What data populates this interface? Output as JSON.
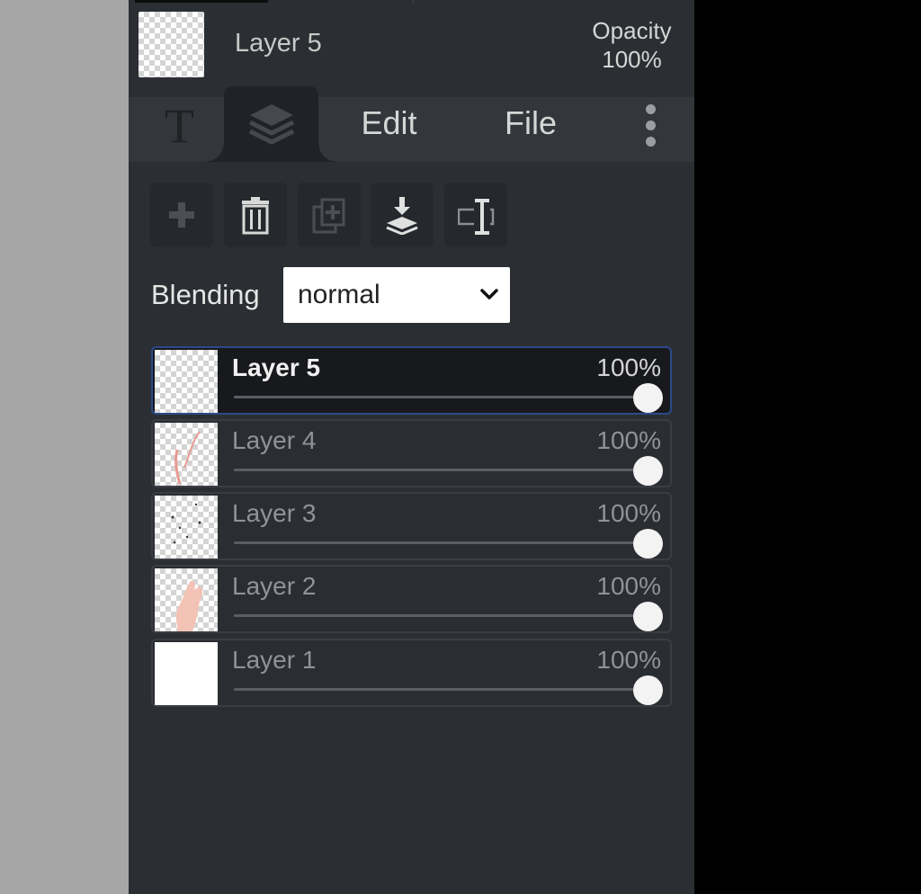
{
  "header": {
    "layer_name": "Layer 5",
    "opacity_label": "Opacity",
    "opacity_value": "100%"
  },
  "tabs": {
    "text_icon_glyph": "T",
    "layers_icon": "layers-stack-icon",
    "edit_label": "Edit",
    "file_label": "File",
    "more_icon": "kebab-menu-icon"
  },
  "toolbar": {
    "buttons": [
      {
        "icon": "add-layer-icon",
        "enabled": false
      },
      {
        "icon": "trash-icon",
        "enabled": true
      },
      {
        "icon": "duplicate-icon",
        "enabled": false
      },
      {
        "icon": "merge-down-icon",
        "enabled": true
      },
      {
        "icon": "rename-icon",
        "enabled": true
      }
    ]
  },
  "blending": {
    "label": "Blending",
    "selected": "normal"
  },
  "layers": [
    {
      "name": "Layer 5",
      "opacity": "100%",
      "opacity_fraction": 1.0,
      "selected": true,
      "thumb": "transparent"
    },
    {
      "name": "Layer 4",
      "opacity": "100%",
      "opacity_fraction": 1.0,
      "selected": false,
      "thumb": "pink-strokes"
    },
    {
      "name": "Layer 3",
      "opacity": "100%",
      "opacity_fraction": 1.0,
      "selected": false,
      "thumb": "dark-dots"
    },
    {
      "name": "Layer 2",
      "opacity": "100%",
      "opacity_fraction": 1.0,
      "selected": false,
      "thumb": "skin-hand"
    },
    {
      "name": "Layer 1",
      "opacity": "100%",
      "opacity_fraction": 1.0,
      "selected": false,
      "thumb": "white-fill"
    }
  ],
  "colors": {
    "panel_bg": "#2b2e32",
    "selected_border": "#2b4a8a",
    "canvas_gray": "#a6a6a6"
  }
}
